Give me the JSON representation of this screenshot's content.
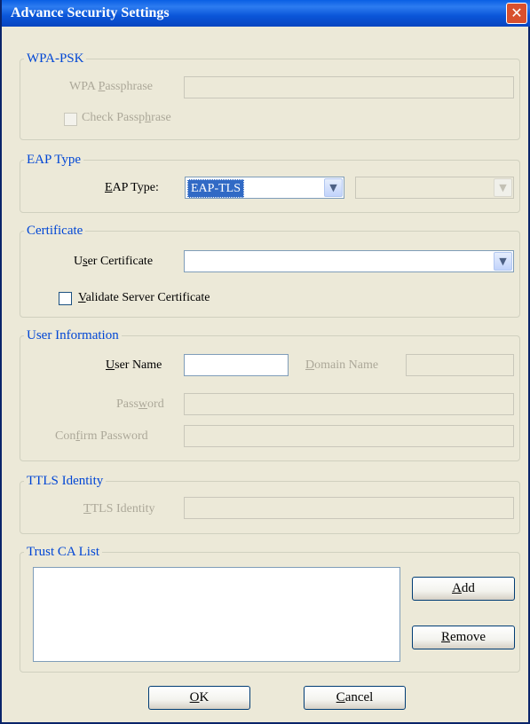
{
  "window": {
    "title": "Advance Security Settings",
    "close_glyph": "✕"
  },
  "wpa_psk": {
    "legend": "WPA-PSK",
    "passphrase_label_pre": "WPA ",
    "passphrase_label_ul": "P",
    "passphrase_label_post": "assphrase",
    "passphrase_value": "",
    "check_label_pre": "Check Passp",
    "check_label_ul": "h",
    "check_label_post": "rase",
    "check_checked": false
  },
  "eap_type": {
    "legend": "EAP Type",
    "label_ul": "E",
    "label_post": "AP Type:",
    "selected": "EAP-TLS",
    "secondary_selected": ""
  },
  "certificate": {
    "legend": "Certificate",
    "user_cert_label_pre": "U",
    "user_cert_label_ul": "s",
    "user_cert_label_post": "er Certificate",
    "user_cert_selected": "",
    "validate_label_ul": "V",
    "validate_label_post": "alidate Server Certificate",
    "validate_checked": false
  },
  "user_info": {
    "legend": "User Information",
    "user_name_label_ul": "U",
    "user_name_label_post": "ser Name",
    "user_name_value": "",
    "domain_label_ul": "D",
    "domain_label_post": "omain Name",
    "domain_value": "",
    "password_label_pre": "Pass",
    "password_label_ul": "w",
    "password_label_post": "ord",
    "password_value": "",
    "confirm_label_pre": "Con",
    "confirm_label_ul": "f",
    "confirm_label_post": "irm Password",
    "confirm_value": ""
  },
  "ttls": {
    "legend": "TTLS Identity",
    "label_ul": "T",
    "label_post": "TLS Identity",
    "value": ""
  },
  "trust_ca": {
    "legend": "Trust CA List",
    "items": [],
    "add_ul": "A",
    "add_post": "dd",
    "remove_ul": "R",
    "remove_post": "emove"
  },
  "footer": {
    "ok_ul": "O",
    "ok_post": "K",
    "cancel_ul": "C",
    "cancel_post": "ancel"
  },
  "icons": {
    "dropdown_arrow": "▼"
  },
  "colors": {
    "titlebar": "#0A5FE4",
    "group_legend": "#0046D5",
    "selection": "#316AC5",
    "close": "#D8502E"
  }
}
